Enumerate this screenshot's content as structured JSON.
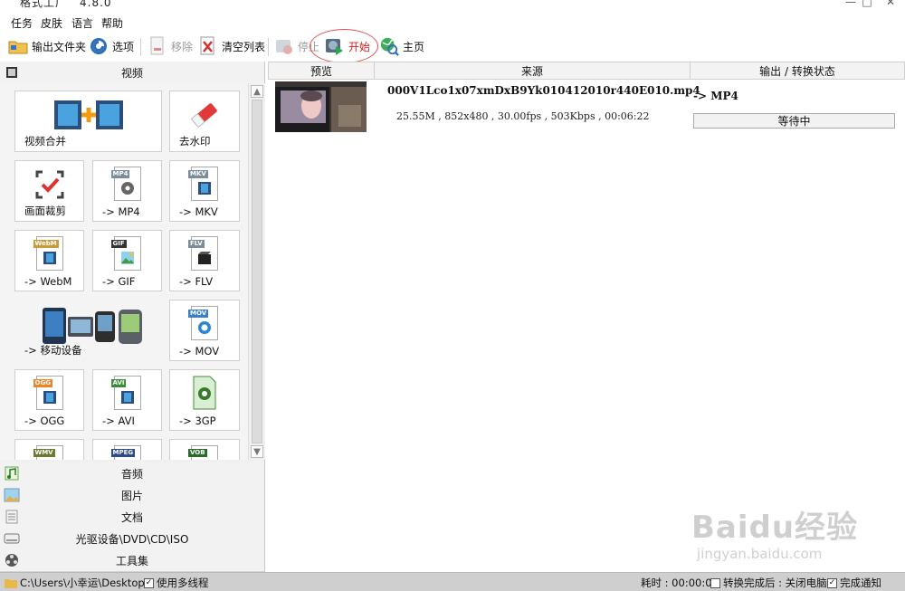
{
  "window": {
    "title": "格式工厂",
    "version": "4.8.0",
    "controls": [
      "—",
      "□",
      "✕"
    ]
  },
  "menu": [
    "任务",
    "皮肤",
    "语言",
    "帮助"
  ],
  "toolbar": {
    "output_folder": "输出文件夹",
    "options": "选项",
    "remove": "移除",
    "clear_list": "清空列表",
    "stop": "停止",
    "start": "开始",
    "home": "主页"
  },
  "left": {
    "video_category": "视频",
    "tiles": {
      "merge": "视频合并",
      "watermark": "去水印",
      "crop": "画面裁剪",
      "mp4": "-> MP4",
      "mkv": "-> MKV",
      "webm": "-> WebM",
      "gif": "-> GIF",
      "flv": "-> FLV",
      "mobile": "-> 移动设备",
      "mov": "-> MOV",
      "ogg": "-> OGG",
      "avi": "-> AVI",
      "3gp": "-> 3GP"
    },
    "file_tags": {
      "mp4": "MP4",
      "mkv": "MKV",
      "webm": "WebM",
      "gif": "GIF",
      "flv": "FLV",
      "mov": "MOV",
      "ogg": "OGG",
      "avi": "AVI",
      "wmv": "WMV",
      "mpeg": "MPEG",
      "vob": "VOB"
    },
    "categories": [
      "音频",
      "图片",
      "文档",
      "光驱设备\\DVD\\CD\\ISO",
      "工具集"
    ]
  },
  "list": {
    "columns": {
      "preview": "预览",
      "source": "来源",
      "output": "输出 / 转换状态"
    },
    "rows": [
      {
        "filename": "000V1Lco1x07xmDxB9Yk010412010r440E010.mp4",
        "info": "25.55M , 852x480 , 30.00fps , 503Kbps , 00:06:22",
        "target": "-> MP4",
        "status": "等待中"
      }
    ]
  },
  "statusbar": {
    "path": "C:\\Users\\小幸运\\Desktop",
    "multithread": "使用多线程",
    "elapsed": "耗时 : 00:00:00",
    "after_done": "转换完成后 : 关闭电脑",
    "notify": "完成通知"
  },
  "watermark": {
    "brand": "Baidu经验",
    "url": "jingyan.baidu.com"
  }
}
